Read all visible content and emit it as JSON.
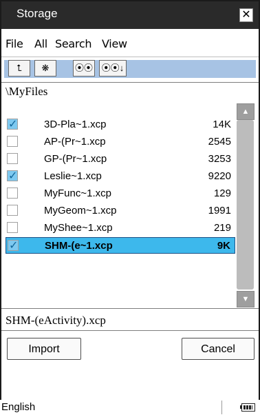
{
  "window": {
    "title": "Storage",
    "close_label": "✕"
  },
  "menu": [
    "File",
    "All",
    "Search",
    "View"
  ],
  "toolbar": {
    "buttons": [
      {
        "icon": "up-folder-icon",
        "glyph": "⮤"
      },
      {
        "icon": "new-folder-icon",
        "glyph": "❋"
      },
      {
        "icon": "search-icon",
        "glyph": "⦿⦿"
      },
      {
        "icon": "search-next-icon",
        "glyph": "⦿⦿↓"
      }
    ]
  },
  "path": "\\MyFiles",
  "files": [
    {
      "name": "3D-Pla~1.xcp",
      "size": "14K",
      "checked": true,
      "selected": false
    },
    {
      "name": "AP-(Pr~1.xcp",
      "size": "2545",
      "checked": false,
      "selected": false
    },
    {
      "name": "GP-(Pr~1.xcp",
      "size": "3253",
      "checked": false,
      "selected": false
    },
    {
      "name": "Leslie~1.xcp",
      "size": "9220",
      "checked": true,
      "selected": false
    },
    {
      "name": "MyFunc~1.xcp",
      "size": "129",
      "checked": false,
      "selected": false
    },
    {
      "name": "MyGeom~1.xcp",
      "size": "1991",
      "checked": false,
      "selected": false
    },
    {
      "name": "MyShee~1.xcp",
      "size": "219",
      "checked": false,
      "selected": false
    },
    {
      "name": "SHM-(e~1.xcp",
      "size": "9K",
      "checked": true,
      "selected": true
    }
  ],
  "full_filename": "SHM-(eActivity).xcp",
  "buttons": {
    "import": "Import",
    "cancel": "Cancel"
  },
  "status": {
    "language": "English"
  },
  "colors": {
    "selection": "#3db8ec",
    "toolbar_area": "#a7c3e4",
    "titlebar": "#2a2a2a"
  }
}
